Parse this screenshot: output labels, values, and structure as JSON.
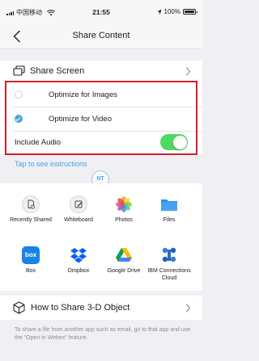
{
  "status_bar": {
    "carrier": "中国移动",
    "time": "21:55",
    "battery_percent": "100%",
    "battery_level": 1.0
  },
  "nav": {
    "title": "Share Content"
  },
  "share_screen": {
    "label": "Share Screen"
  },
  "screen_options": {
    "optimize_images": {
      "label": "Optimize for Images",
      "selected": false
    },
    "optimize_video": {
      "label": "Optimize for Video",
      "selected": true
    },
    "include_audio": {
      "label": "Include Audio",
      "on": true
    }
  },
  "instructions_link": "Tap to see instructions",
  "watermark_text": "NT",
  "apps": [
    {
      "label": "Recently Shared",
      "icon": "document-clock-icon"
    },
    {
      "label": "Whiteboard",
      "icon": "pencil-icon"
    },
    {
      "label": "Photos",
      "icon": "photos-icon"
    },
    {
      "label": "Files",
      "icon": "folder-icon"
    },
    {
      "label": "Box",
      "icon": "box-icon",
      "icon_text": "box"
    },
    {
      "label": "Dropbox",
      "icon": "dropbox-icon"
    },
    {
      "label": "Google Drive",
      "icon": "google-drive-icon"
    },
    {
      "label": "IBM Connections Cloud",
      "icon": "ibm-connections-icon"
    }
  ],
  "share_3d": {
    "label": "How to Share 3-D Object"
  },
  "footer_text": "To share a file from another app such as email, go to that app and use the \"Open in Webex\" feature.",
  "colors": {
    "accent": "#47a7d9",
    "toggle_on": "#4cd964",
    "highlight": "#d42026",
    "background": "#efeff4"
  }
}
